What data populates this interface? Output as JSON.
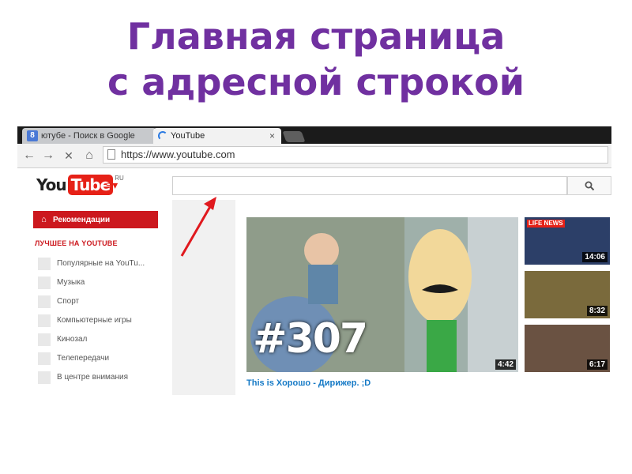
{
  "slide": {
    "title_line1": "Главная страница",
    "title_line2": "с адресной строкой"
  },
  "browser": {
    "tabs": [
      {
        "label": "ютубе - Поиск в Google",
        "icon": "google-icon",
        "icon_glyph": "8",
        "active": false
      },
      {
        "label": "YouTube",
        "icon": "loading-icon",
        "active": true,
        "close_glyph": "×"
      }
    ],
    "toolbar": {
      "back_glyph": "←",
      "forward_glyph": "→",
      "stop_glyph": "✕",
      "home_glyph": "⌂",
      "url": "https://www.youtube.com"
    }
  },
  "youtube": {
    "logo_you": "You",
    "logo_tube": "Tube",
    "logo_region": "RU",
    "guide_glyph": "≡▾",
    "search_placeholder": "",
    "search_icon_glyph": "🔍",
    "sidebar": {
      "home_glyph": "⌂",
      "recommendations": "Рекомендации",
      "best_title": "ЛУЧШЕЕ НА YOUTUBE",
      "items": [
        "Популярные на YouTu...",
        "Музыка",
        "Спорт",
        "Компьютерные игры",
        "Кинозал",
        "Телепередачи",
        "В центре внимания"
      ]
    },
    "featured": {
      "overlay_text": "#307",
      "duration": "4:42",
      "title": "This is Хорошо - Дирижер. ;D"
    },
    "side_videos": [
      {
        "duration": "14:06",
        "channel_badge": "LIFE NEWS"
      },
      {
        "duration": "8:32"
      },
      {
        "duration": "6:17"
      }
    ]
  },
  "colors": {
    "slide_title": "#7030a0",
    "youtube_red": "#e62117",
    "annotation_arrow": "#e0191e"
  }
}
